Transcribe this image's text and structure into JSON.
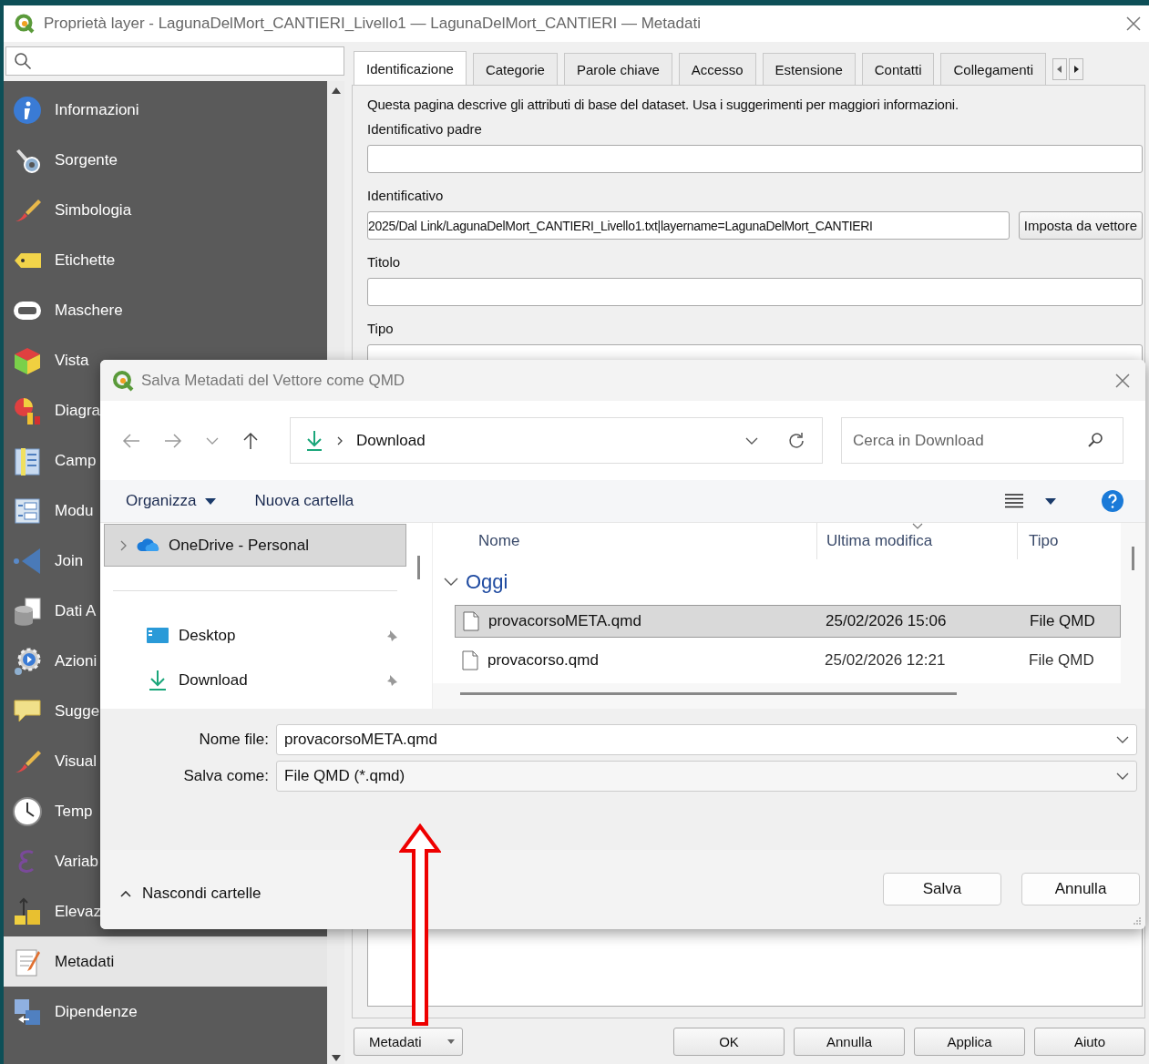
{
  "window": {
    "title": "Proprietà layer - LagunaDelMort_CANTIERI_Livello1 — LagunaDelMort_CANTIERI — Metadati"
  },
  "sidebar": {
    "items": [
      {
        "label": "Informazioni",
        "selected": false
      },
      {
        "label": "Sorgente",
        "selected": false
      },
      {
        "label": "Simbologia",
        "selected": false
      },
      {
        "label": "Etichette",
        "selected": false
      },
      {
        "label": "Maschere",
        "selected": false
      },
      {
        "label": "Vista",
        "selected": false
      },
      {
        "label": "Diagra",
        "selected": false
      },
      {
        "label": "Camp",
        "selected": false
      },
      {
        "label": "Modu",
        "selected": false
      },
      {
        "label": "Join",
        "selected": false
      },
      {
        "label": "Dati A",
        "selected": false
      },
      {
        "label": "Azioni",
        "selected": false
      },
      {
        "label": "Sugge",
        "selected": false
      },
      {
        "label": "Visual",
        "selected": false
      },
      {
        "label": "Temp",
        "selected": false
      },
      {
        "label": "Variab",
        "selected": false
      },
      {
        "label": "Elevaz",
        "selected": false
      },
      {
        "label": "Metadati",
        "selected": true
      },
      {
        "label": "Dipendenze",
        "selected": false
      }
    ]
  },
  "tabs": [
    {
      "label": "Identificazione",
      "selected": true
    },
    {
      "label": "Categorie",
      "selected": false
    },
    {
      "label": "Parole chiave",
      "selected": false
    },
    {
      "label": "Accesso",
      "selected": false
    },
    {
      "label": "Estensione",
      "selected": false
    },
    {
      "label": "Contatti",
      "selected": false
    },
    {
      "label": "Collegamenti",
      "selected": false
    }
  ],
  "panel": {
    "description": "Questa pagina descrive gli attributi di base del dataset. Usa i suggerimenti per maggiori informazioni.",
    "fields": [
      {
        "kind": "text",
        "label": "Identificativo padre"
      },
      {
        "kind": "text-button",
        "label": "Identificativo",
        "value": "2025/Dal Link/LagunaDelMort_CANTIERI_Livello1.txt|layername=LagunaDelMort_CANTIERI",
        "button": "Imposta da vettore"
      },
      {
        "kind": "text",
        "label": "Titolo"
      },
      {
        "kind": "combo",
        "label": "Tipo"
      }
    ]
  },
  "style_menu": "Metadati",
  "buttons": [
    "OK",
    "Annulla",
    "Applica",
    "Aiuto"
  ],
  "dialog": {
    "title": "Salva Metadati del Vettore come QMD",
    "location": "Download",
    "search": {
      "placeholder": "Cerca in Download"
    },
    "organize": "Organizza",
    "new_folder": "Nuova cartella",
    "nav_pane": [
      {
        "label": "OneDrive - Personal",
        "selected": true,
        "pinned": false
      },
      {
        "label": "Desktop",
        "selected": false,
        "pinned": true
      },
      {
        "label": "Download",
        "selected": false,
        "pinned": true
      }
    ],
    "columns": [
      "Nome",
      "Ultima modifica",
      "Tipo"
    ],
    "group": {
      "label": "Oggi",
      "expanded": true
    },
    "files": [
      {
        "name": "provacorsoMETA.qmd",
        "modified": "25/02/2026 15:06",
        "type": "File QMD",
        "selected": true
      },
      {
        "name": "provacorso.qmd",
        "modified": "25/02/2026 12:21",
        "type": "File QMD",
        "selected": false
      }
    ],
    "filename_label": "Nome file:",
    "filename": "provacorsoMETA.qmd",
    "savetype_label": "Salva come:",
    "savetype": "File QMD (*.qmd)",
    "hide_folders": "Nascondi cartelle",
    "buttons": [
      "Salva",
      "Annulla"
    ]
  }
}
